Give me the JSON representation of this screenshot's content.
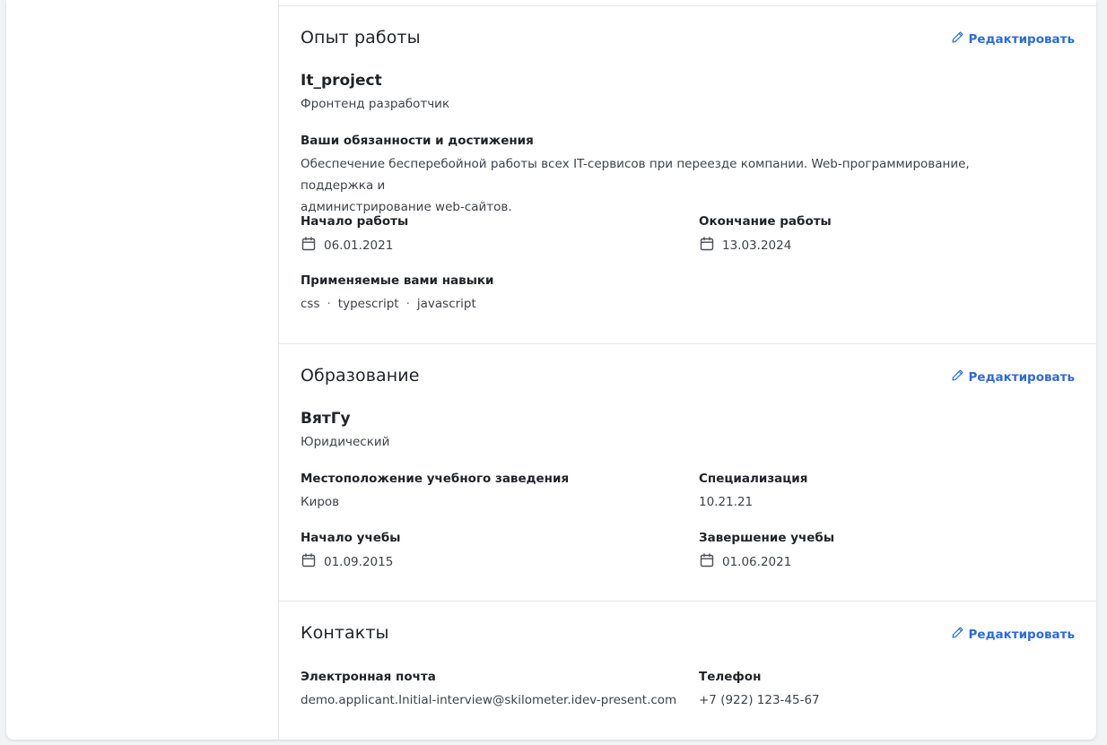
{
  "edit_label": "Редактировать",
  "work": {
    "title": "Опыт работы",
    "company": "It_project",
    "position": "Фронтенд разработчик",
    "duties_label": "Ваши обязанности и достижения",
    "duties_line1": "Обеспечение бесперебойной работы всех IT-сервисов при переезде компании. Web-программирование, поддержка и",
    "duties_line2": "администрирование web-сайтов.",
    "start_label": "Начало работы",
    "start_value": "06.01.2021",
    "end_label": "Окончание работы",
    "end_value": "13.03.2024",
    "skills_label": "Применяемые вами навыки",
    "skills": [
      "css",
      "typescript",
      "javascript"
    ]
  },
  "education": {
    "title": "Образование",
    "institution": "ВятГу",
    "faculty": "Юридический",
    "location_label": "Местоположение учебного заведения",
    "location_value": "Киров",
    "specialization_label": "Специализация",
    "specialization_value": "10.21.21",
    "start_label": "Начало учебы",
    "start_value": "01.09.2015",
    "end_label": "Завершение учебы",
    "end_value": "01.06.2021"
  },
  "contacts": {
    "title": "Контакты",
    "email_label": "Электронная почта",
    "email_value": "demo.applicant.Initial-interview@skilometer.idev-present.com",
    "phone_label": "Телефон",
    "phone_value": "+7 (922) 123-45-67"
  },
  "colors": {
    "accent": "#2d6bd4",
    "border": "#e3e5e8",
    "background": "#f2f3f5"
  },
  "icons": {
    "edit": "pencil-icon",
    "date": "calendar-icon"
  }
}
